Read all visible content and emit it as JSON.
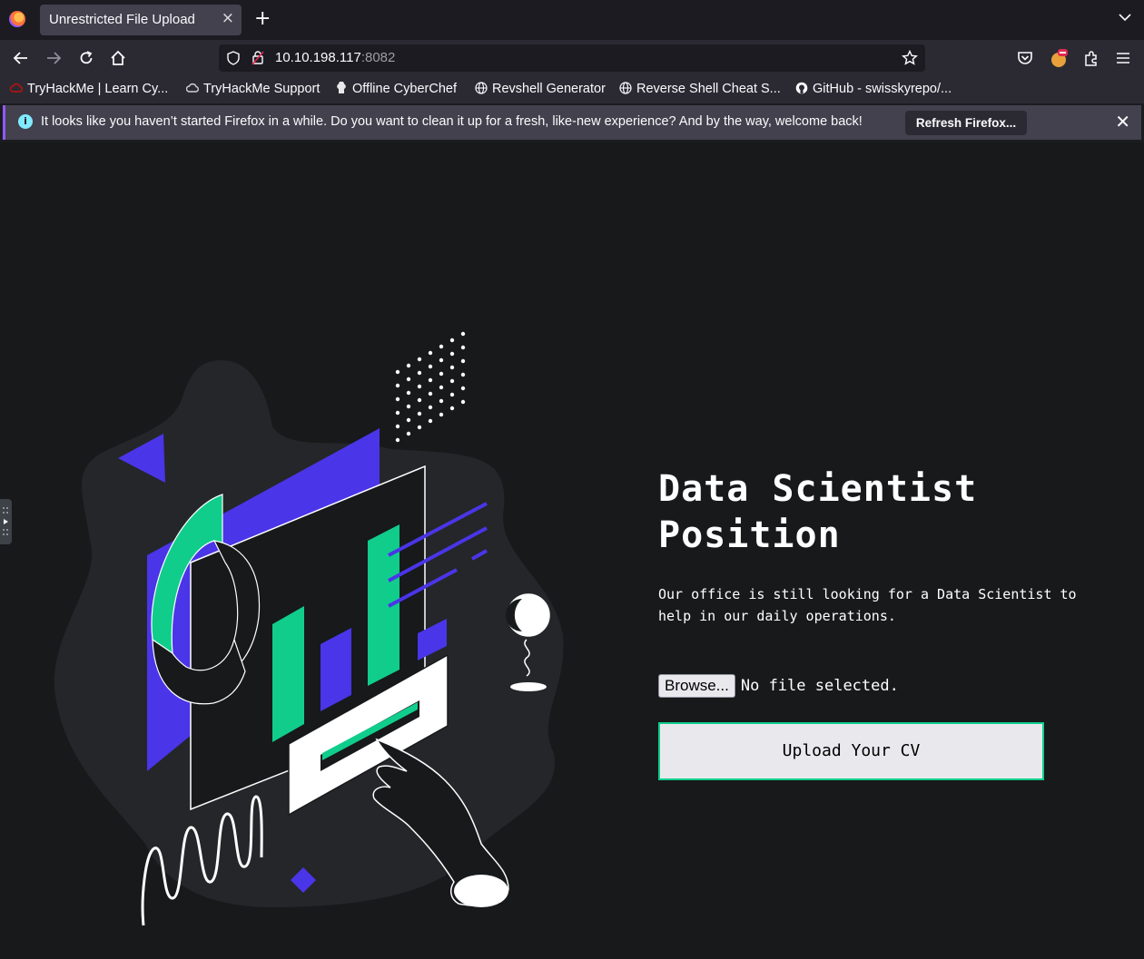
{
  "browser": {
    "tab_title": "Unrestricted File Upload",
    "url_host": "10.10.198.117",
    "url_port": ":8082",
    "bookmarks": [
      "TryHackMe | Learn Cy...",
      "TryHackMe Support",
      "Offline CyberChef",
      "Revshell Generator",
      "Reverse Shell Cheat S...",
      "GitHub - swisskyrepo/..."
    ],
    "notice_text": "It looks like you haven’t started Firefox in a while. Do you want to clean it up for a fresh, like-new experience? And by the way, welcome back!",
    "refresh_label": "Refresh Firefox..."
  },
  "page": {
    "heading_line1": "Data Scientist",
    "heading_line2": "Position",
    "description": "Our office is still looking for a Data Scientist to help in our daily operations.",
    "browse_label": "Browse...",
    "file_status": "No file selected.",
    "upload_label": "Upload Your CV"
  },
  "colors": {
    "accent_green": "#10cd8c",
    "accent_purple": "#4a35e8",
    "background": "#17191b"
  }
}
